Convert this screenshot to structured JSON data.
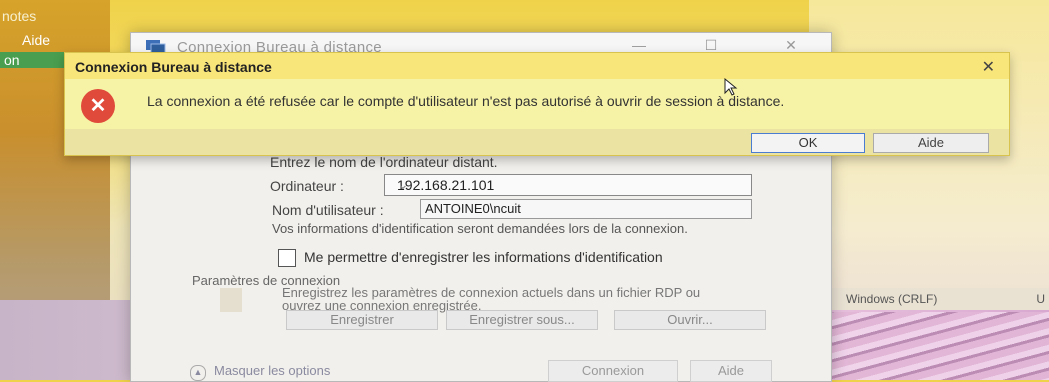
{
  "background_app": {
    "menu_items": [
      "notes",
      "Aide",
      "on"
    ],
    "status_encoding": "Windows (CRLF)",
    "status_extra": "U"
  },
  "rdp_window": {
    "title": "Connexion Bureau à distance",
    "minimize": "—",
    "maximize": "☐",
    "close": "✕",
    "intro": "Entrez le nom de l'ordinateur distant.",
    "computer_label": "Ordinateur :",
    "computer_value": "192.168.21.101",
    "username_label": "Nom d'utilisateur :",
    "username_value": "ANTOINE0\\ncuit",
    "credentials_info": "Vos informations d'identification seront demandées lors de la connexion.",
    "remember_label": "Me permettre d'enregistrer les informations d'identification",
    "remember_checked": false,
    "settings_group": "Paramètres de connexion",
    "settings_text": "Enregistrez les paramètres de connexion actuels dans un fichier RDP ou ouvrez une connexion enregistrée.",
    "btn_save": "Enregistrer",
    "btn_save_as": "Enregistrer sous...",
    "btn_open": "Ouvrir...",
    "options_toggle": "Masquer les options",
    "btn_connect": "Connexion",
    "btn_help": "Aide"
  },
  "error_dialog": {
    "title": "Connexion Bureau à distance",
    "close": "✕",
    "icon": "error-x-icon",
    "message": "La connexion a été refusée car le compte d'utilisateur n'est pas autorisé à ouvrir de session à distance.",
    "ok_label": "OK",
    "help_label": "Aide"
  },
  "colors": {
    "error_icon": "#e04a3a",
    "dialog_bg": "#f7f3a6",
    "focus_border": "#4a7cd1"
  }
}
